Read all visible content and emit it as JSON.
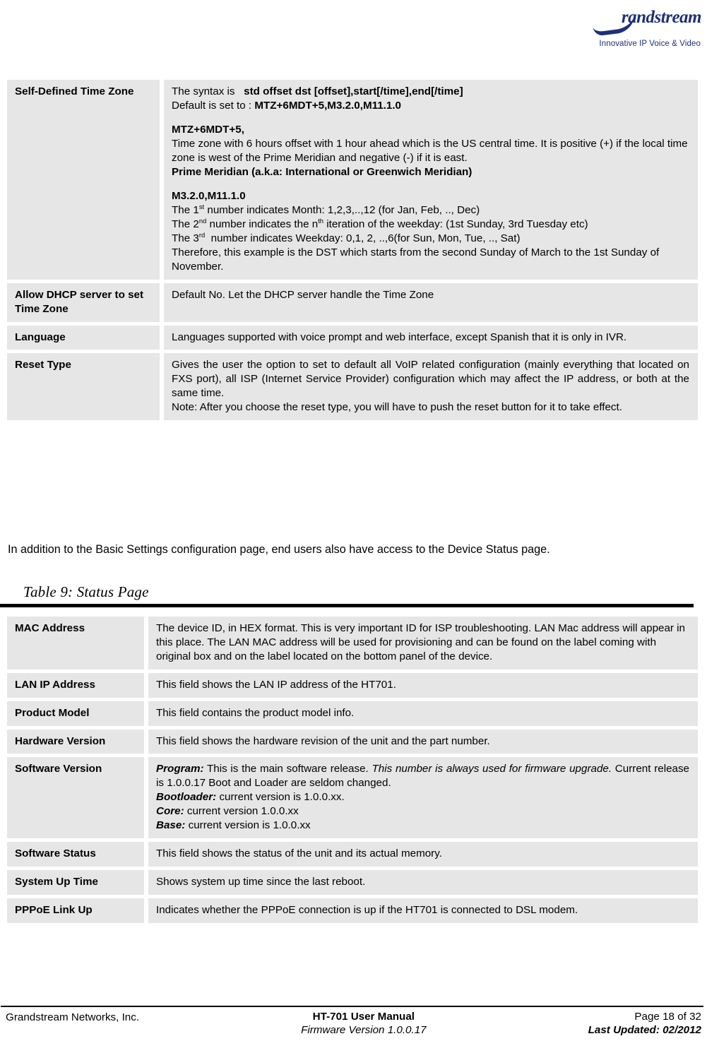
{
  "header": {
    "logo_wordmark": "randstream",
    "logo_tagline": "Innovative IP Voice & Video"
  },
  "settings_table": {
    "rows": [
      {
        "label": "Self-Defined Time Zone",
        "desc_lines": [
          "The syntax is   std offset dst [offset],start[/time],end[/time]",
          "Default is set to : MTZ+6MDT+5,M3.2.0,M11.1.0",
          "MTZ+6MDT+5,",
          "Time zone with 6 hours offset with 1 hour ahead which is the US central time. It is positive (+) if the local time zone is west of the Prime Meridian and negative (-) if it is east.",
          "Prime Meridian (a.k.a: International or Greenwich Meridian)",
          "M3.2.0,M11.1.0",
          "The 1st number indicates Month: 1,2,3,..,12 (for Jan, Feb, .., Dec)",
          "The 2nd number indicates the nth iteration of the weekday: (1st Sunday, 3rd Tuesday etc)",
          "The 3rd  number indicates Weekday: 0,1, 2, ..,6(for Sun, Mon, Tue, .., Sat)",
          "Therefore, this example is the DST which starts from the second Sunday of March to the 1st Sunday of November."
        ]
      },
      {
        "label": "Allow DHCP server to set Time Zone",
        "desc": "Default No. Let the DHCP server handle the Time Zone"
      },
      {
        "label": "Language",
        "desc": "Languages supported with voice prompt and web interface, except Spanish that it is only in IVR."
      },
      {
        "label": "Reset Type",
        "desc": "Gives the user the option to set to default all VoIP related configuration (mainly everything that located on FXS port), all ISP (Internet Service Provider) configuration which may affect the IP address, or both at the same time.",
        "desc2": "Note: After you choose the reset type, you will have to push the reset button for it to take effect."
      }
    ]
  },
  "body_paragraph": "In addition to the Basic Settings configuration page, end users also have access to the Device Status page.",
  "table_caption": "Table 9:  Status Page",
  "status_table": {
    "rows": [
      {
        "label": "MAC Address",
        "desc": "The device ID, in HEX format.  This is very important ID for ISP troubleshooting. LAN Mac address will appear in this place. The LAN MAC address will be used for provisioning and can be found on the label coming with original box and on the label located on the bottom panel of the device."
      },
      {
        "label": "LAN IP Address",
        "desc": "This field shows the LAN IP address of the HT701."
      },
      {
        "label": "Product Model",
        "desc": "This field contains the product model info."
      },
      {
        "label": "Hardware Version",
        "desc": "This field shows the hardware revision of the unit and the part number."
      },
      {
        "label": "Software Version",
        "desc_parts": {
          "program_key": "Program:",
          "program_text_1": " This is the main software release. ",
          "program_italic": "This number is always used for firmware upgrade.",
          "program_text_2": "  Current release is 1.0.0.17 Boot and Loader are seldom changed.",
          "bootloader_key": "Bootloader:",
          "bootloader_text": " current version is 1.0.0.xx.",
          "core_key": "Core:",
          "core_text": "   current version 1.0.0.xx",
          "base_key": "Base:",
          "base_text": "   current version is 1.0.0.xx"
        }
      },
      {
        "label": "Software Status",
        "desc": "This field shows the status of the unit and its actual memory."
      },
      {
        "label": "System Up Time",
        "desc": "Shows system up time since the last reboot."
      },
      {
        "label": "PPPoE Link Up",
        "desc": "Indicates whether the PPPoE connection is up if the HT701 is connected to DSL modem."
      }
    ]
  },
  "footer": {
    "company": "Grandstream Networks, Inc.",
    "manual_title": "HT-701 User Manual",
    "firmware": "Firmware Version 1.0.0.17",
    "page_number": "Page 18 of 32",
    "last_updated": "Last Updated: 02/2012"
  }
}
